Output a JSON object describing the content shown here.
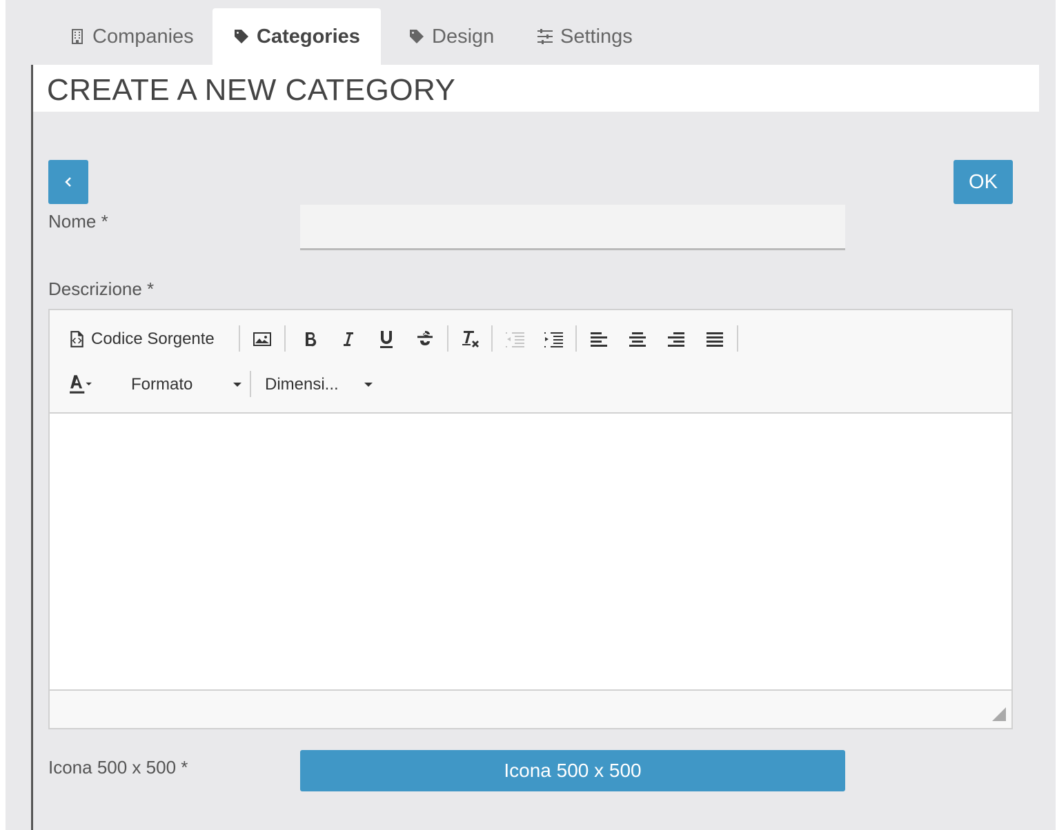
{
  "tabs": [
    {
      "label": "Companies",
      "icon": "building-icon"
    },
    {
      "label": "Categories",
      "icon": "tag-icon",
      "active": true
    },
    {
      "label": "Design",
      "icon": "tag-icon"
    },
    {
      "label": "Settings",
      "icon": "sliders-icon"
    }
  ],
  "page": {
    "title": "CREATE A NEW CATEGORY",
    "ok_label": "OK"
  },
  "form": {
    "nome_label": "Nome *",
    "nome_value": "",
    "descrizione_label": "Descrizione *",
    "icona_label": "Icona 500 x 500 *",
    "icona_button": "Icona 500 x 500"
  },
  "editor": {
    "source_label": "Codice Sorgente",
    "format_label": "Formato",
    "size_label": "Dimensi..."
  },
  "colors": {
    "accent": "#4097c6",
    "background": "#e9e9eb"
  }
}
